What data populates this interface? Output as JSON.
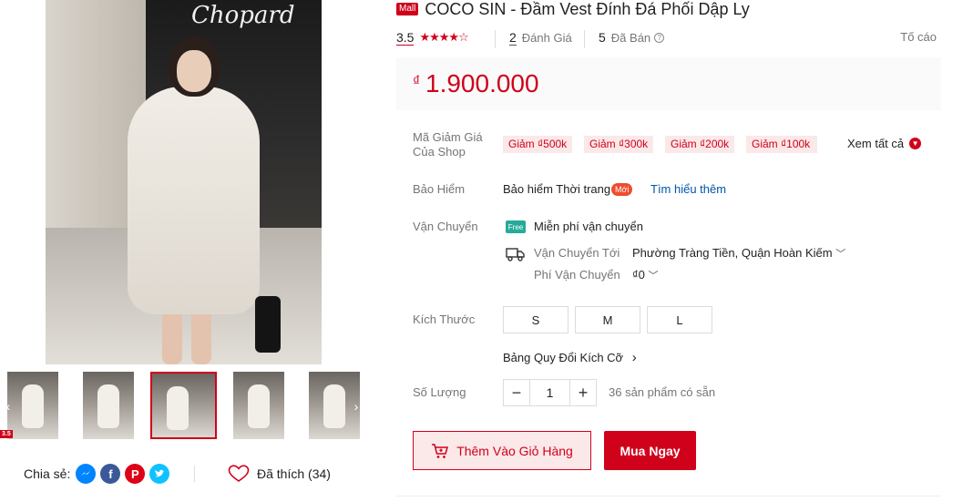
{
  "product": {
    "mall_badge": "Mall",
    "title": "COCO SIN - Đầm Vest Đính Đá Phối Dập Ly",
    "rating": "3.5",
    "reviews_count": "2",
    "reviews_label": "Đánh Giá",
    "sold_count": "5",
    "sold_label": "Đã Bán",
    "report_label": "Tố cáo",
    "currency_symbol": "₫",
    "price": "1.900.000"
  },
  "gallery": {
    "store_sign": "Chopard",
    "thumb_badge": "3.5",
    "share_label": "Chia sẻ:",
    "like_label": "Đã thích (34)",
    "prev_arrow": "‹",
    "next_arrow": "›"
  },
  "vouchers": {
    "label": "Mã Giảm Giá\nCủa Shop",
    "items": [
      "Giảm ₫500k",
      "Giảm ₫300k",
      "Giảm ₫200k",
      "Giảm ₫100k"
    ],
    "see_all": "Xem tất cả"
  },
  "insurance": {
    "label": "Bảo Hiểm",
    "text": "Bảo hiểm Thời trang",
    "badge": "Mới",
    "learn_more": "Tìm hiểu thêm"
  },
  "shipping": {
    "label": "Vận Chuyển",
    "free_icon_text": "Free",
    "free_text": "Miễn phí vận chuyển",
    "to_label": "Vận Chuyển Tới",
    "to_value": "Phường Tràng Tiền, Quận Hoàn Kiếm",
    "fee_label": "Phí Vận Chuyển",
    "fee_value": "₫0"
  },
  "size": {
    "label": "Kích Thước",
    "options": [
      "S",
      "M",
      "L"
    ],
    "chart_link": "Bảng Quy Đổi Kích Cỡ"
  },
  "quantity": {
    "label": "Số Lượng",
    "value": "1",
    "minus": "−",
    "plus": "+",
    "stock": "36 sản phẩm có sẵn"
  },
  "actions": {
    "add_to_cart": "Thêm Vào Giỏ Hàng",
    "buy_now": "Mua Ngay"
  },
  "colors": {
    "brand_red": "#d0011b",
    "voucher_bg": "#fbe8e8",
    "link_blue": "#0055aa",
    "free_ship_green": "#26aa99"
  }
}
